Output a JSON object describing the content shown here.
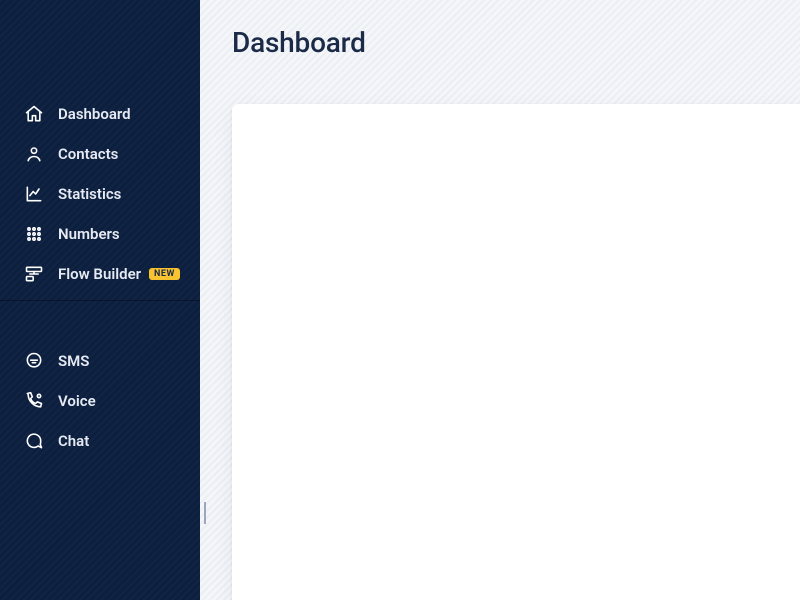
{
  "page": {
    "title": "Dashboard"
  },
  "sidebar": {
    "primary": [
      {
        "label": "Dashboard"
      },
      {
        "label": "Contacts"
      },
      {
        "label": "Statistics"
      },
      {
        "label": "Numbers"
      },
      {
        "label": "Flow Builder",
        "badge": "NEW"
      }
    ],
    "secondary": [
      {
        "label": "SMS"
      },
      {
        "label": "Voice"
      },
      {
        "label": "Chat"
      }
    ]
  }
}
